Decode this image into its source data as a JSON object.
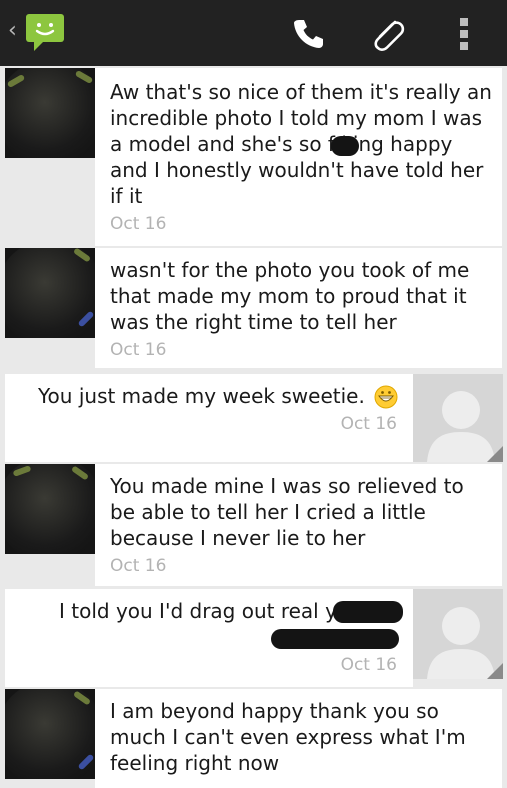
{
  "header": {
    "back": "‹",
    "icons": [
      "messaging-app-icon",
      "phone-icon",
      "paperclip-icon",
      "overflow-menu-icon"
    ],
    "colors": {
      "bar": "#222222",
      "app_icon": "#8dc63f"
    }
  },
  "messages": [
    {
      "dir": "in",
      "text": "Aw that's so nice of them it's really an\nincredible photo I told my mom I was\na model and she's so f  king happy\nand I honestly wouldn't have told her\nif it",
      "time": "Oct 16"
    },
    {
      "dir": "in",
      "text": "wasn't for the photo you took of me\nthat made my mom to proud that it\nwas the right time to tell her",
      "time": "Oct 16"
    },
    {
      "dir": "out",
      "text": "You just made my week sweetie.",
      "emoji": "grinning-emoji",
      "time": "Oct 16"
    },
    {
      "dir": "in",
      "text": "You made mine I was so relieved to\nbe able to tell her I cried a little\nbecause I never lie to her",
      "time": "Oct 16"
    },
    {
      "dir": "out",
      "text": "I told you I'd drag out real you",
      "time": "Oct 16"
    },
    {
      "dir": "in",
      "text": "I am beyond happy thank you so\nmuch I can't even express what I'm\nfeeling right now",
      "time": ""
    }
  ]
}
